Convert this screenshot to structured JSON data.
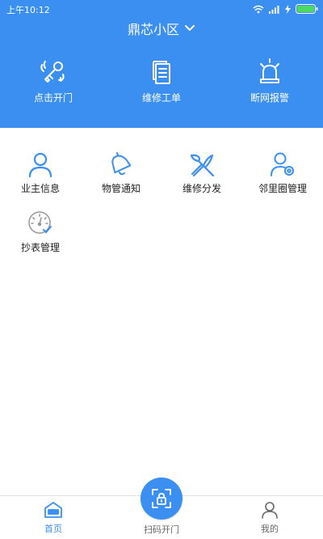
{
  "status": {
    "time": "上午10:12"
  },
  "header": {
    "title": "鼎芯小区"
  },
  "quick_actions": [
    {
      "label": "点击开门",
      "icon": "key-icon"
    },
    {
      "label": "维修工单",
      "icon": "document-icon"
    },
    {
      "label": "断网报警",
      "icon": "alarm-icon"
    }
  ],
  "grid": [
    {
      "label": "业主信息",
      "icon": "person-icon"
    },
    {
      "label": "物管通知",
      "icon": "bell-icon"
    },
    {
      "label": "维修分发",
      "icon": "tools-icon"
    },
    {
      "label": "邻里圈管理",
      "icon": "user-settings-icon"
    },
    {
      "label": "抄表管理",
      "icon": "meter-icon"
    }
  ],
  "bottom_nav": {
    "home": "首页",
    "scan": "扫码开门",
    "mine": "我的"
  },
  "colors": {
    "primary": "#3a8ff0",
    "active": "#3a8ff0",
    "inactive": "#666666"
  }
}
